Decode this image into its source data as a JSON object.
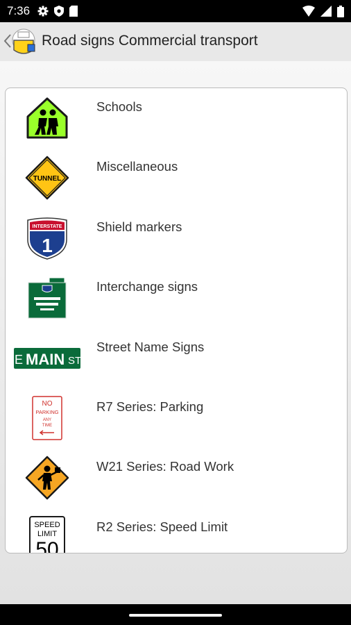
{
  "status": {
    "time": "7:36"
  },
  "app_bar": {
    "title": "Road signs Commercial transport"
  },
  "items": [
    {
      "label": "Schools",
      "icon": "school-sign-icon"
    },
    {
      "label": "Miscellaneous",
      "icon": "tunnel-sign-icon"
    },
    {
      "label": "Shield markers",
      "icon": "interstate-shield-icon",
      "sign_text": "INTERSTATE",
      "sign_number": "1"
    },
    {
      "label": "Interchange signs",
      "icon": "interchange-sign-icon"
    },
    {
      "label": "Street Name Signs",
      "icon": "street-name-sign-icon",
      "sign_text": "E MAIN ST"
    },
    {
      "label": "R7 Series: Parking",
      "icon": "no-parking-sign-icon"
    },
    {
      "label": "W21 Series: Road Work",
      "icon": "road-work-sign-icon"
    },
    {
      "label": "R2 Series: Speed Limit",
      "icon": "speed-limit-sign-icon",
      "sign_text": "SPEED LIMIT",
      "sign_number": "50"
    }
  ],
  "colors": {
    "school_sign": "#9aff2a",
    "warning_sign": "#ffc414",
    "road_work_sign": "#f6a623",
    "guide_green": "#0a6b3a",
    "interstate_blue": "#1d3f8f",
    "interstate_red": "#c8102e",
    "regulatory_red": "#d0312d"
  }
}
